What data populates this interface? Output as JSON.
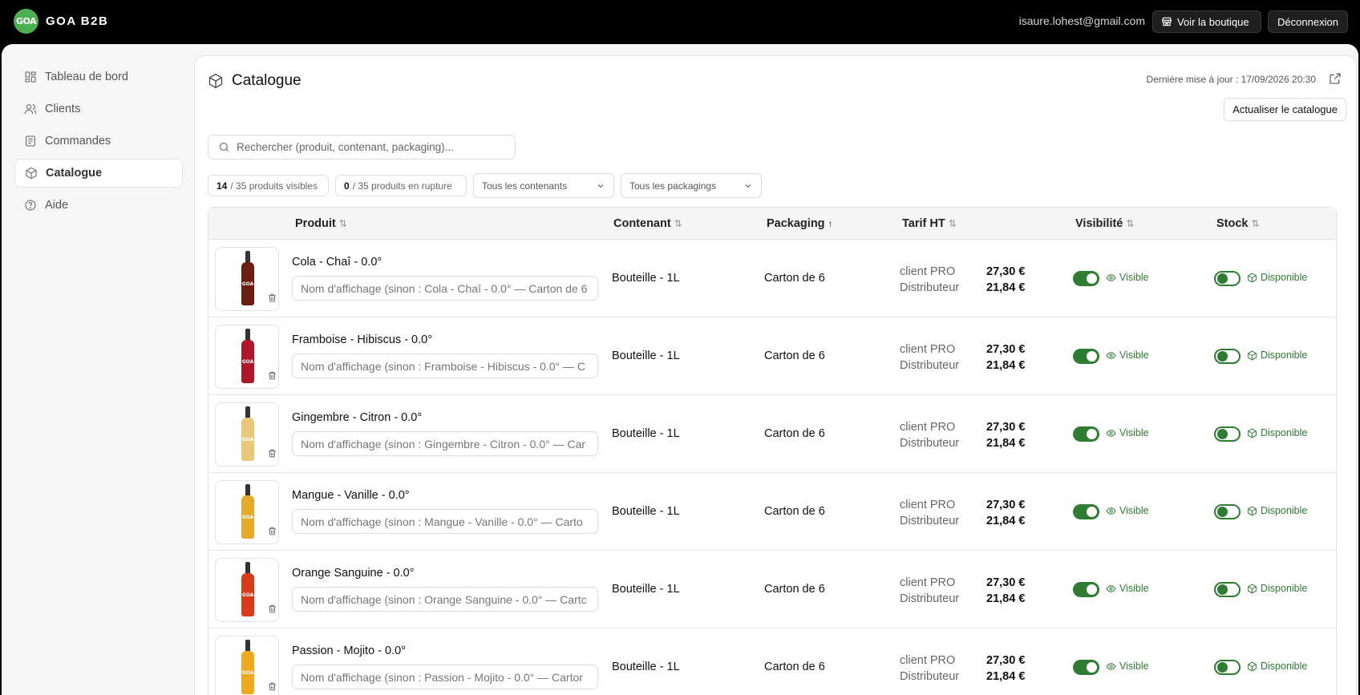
{
  "header": {
    "logo_text": "GOA",
    "brand": "GOA B2B",
    "user_email": "isaure.lohest@gmail.com",
    "shop_button": "Voir la boutique",
    "logout_button": "Déconnexion"
  },
  "sidebar": {
    "items": [
      {
        "label": "Tableau de bord",
        "icon": "dashboard-icon"
      },
      {
        "label": "Clients",
        "icon": "users-icon"
      },
      {
        "label": "Commandes",
        "icon": "orders-icon"
      },
      {
        "label": "Catalogue",
        "icon": "package-icon",
        "active": true
      },
      {
        "label": "Aide",
        "icon": "help-icon"
      }
    ]
  },
  "page": {
    "title": "Catalogue",
    "last_update": "Dernière mise à jour : 17/09/2026 20:30",
    "refresh_button": "Actualiser le catalogue",
    "search_placeholder": "Rechercher (produit, contenant, packaging)..."
  },
  "filters": {
    "visible_count": "14",
    "visible_suffix": "/ 35 produits visibles",
    "rupture_count": "0",
    "rupture_suffix": "/ 35 produits en rupture",
    "contenants_select": "Tous les contenants",
    "packagings_select": "Tous les packagings"
  },
  "table": {
    "columns": {
      "produit": "Produit",
      "contenant": "Contenant",
      "packaging": "Packaging",
      "tarif": "Tarif HT",
      "visibilite": "Visibilité",
      "stock": "Stock"
    },
    "tarif_label_pro": "client PRO",
    "tarif_label_distrib": "Distributeur",
    "visible_label": "Visible",
    "stock_label": "Disponible",
    "rows": [
      {
        "name": "Cola - Chaî - 0.0°",
        "placeholder": "Nom d'affichage (sinon : Cola - Chaî - 0.0° — Carton de 6",
        "contenant": "Bouteille - 1L",
        "packaging": "Carton de 6",
        "price_pro": "27,30 €",
        "price_distrib": "21,84 €",
        "color": "#6b1d12"
      },
      {
        "name": "Framboise - Hibiscus - 0.0°",
        "placeholder": "Nom d'affichage (sinon : Framboise - Hibiscus - 0.0° — C",
        "contenant": "Bouteille - 1L",
        "packaging": "Carton de 6",
        "price_pro": "27,30 €",
        "price_distrib": "21,84 €",
        "color": "#b0162a"
      },
      {
        "name": "Gingembre - Citron - 0.0°",
        "placeholder": "Nom d'affichage (sinon : Gingembre - Citron - 0.0° — Car",
        "contenant": "Bouteille - 1L",
        "packaging": "Carton de 6",
        "price_pro": "27,30 €",
        "price_distrib": "21,84 €",
        "color": "#e9c977"
      },
      {
        "name": "Mangue - Vanille - 0.0°",
        "placeholder": "Nom d'affichage (sinon : Mangue - Vanille - 0.0° — Carto",
        "contenant": "Bouteille - 1L",
        "packaging": "Carton de 6",
        "price_pro": "27,30 €",
        "price_distrib": "21,84 €",
        "color": "#e7a92a"
      },
      {
        "name": "Orange Sanguine - 0.0°",
        "placeholder": "Nom d'affichage (sinon : Orange Sanguine - 0.0° — Cartc",
        "contenant": "Bouteille - 1L",
        "packaging": "Carton de 6",
        "price_pro": "27,30 €",
        "price_distrib": "21,84 €",
        "color": "#d83a1a"
      },
      {
        "name": "Passion - Mojito - 0.0°",
        "placeholder": "Nom d'affichage (sinon : Passion - Mojito - 0.0° — Cartor",
        "contenant": "Bouteille - 1L",
        "packaging": "Carton de 6",
        "price_pro": "27,30 €",
        "price_distrib": "21,84 €",
        "color": "#f0a81c"
      }
    ]
  }
}
